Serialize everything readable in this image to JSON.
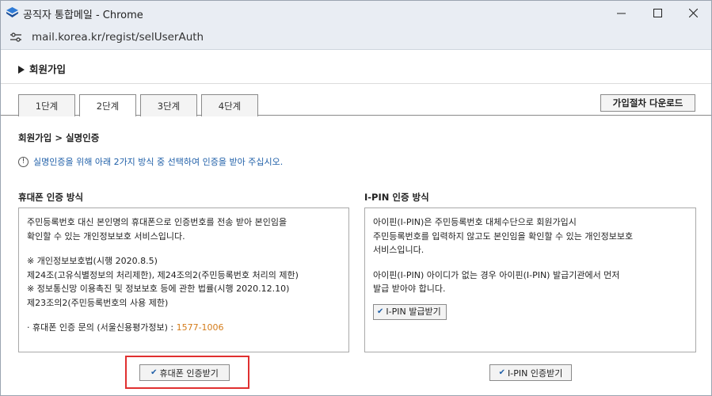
{
  "window": {
    "title": "공직자 통합메일 - Chrome",
    "url": "mail.korea.kr/regist/selUserAuth"
  },
  "page": {
    "title": "회원가입",
    "tabs": [
      {
        "label": "1단계",
        "active": false
      },
      {
        "label": "2단계",
        "active": true
      },
      {
        "label": "3단계",
        "active": false
      },
      {
        "label": "4단계",
        "active": false
      }
    ],
    "download_button": "가입절차 다운로드",
    "breadcrumb": "회원가입 > 실명인증",
    "notice": "실명인증을 위해 아래 2가지 방식 중 선택하여 인증을 받아 주십시오."
  },
  "phone_auth": {
    "title": "휴대폰 인증 방식",
    "lines": [
      "주민등록번호 대신 본인명의 휴대폰으로 인증번호를 전송 받아 본인임을",
      "확인할 수 있는 개인정보보호 서비스입니다."
    ],
    "law_lines": [
      "※ 개인정보보호법(시행 2020.8.5)",
      "제24조(고유식별정보의 처리제한), 제24조의2(주민등록번호 처리의 제한)",
      "※ 정보통신망 이용촉진 및 정보보호 등에 관한 법률(시행 2020.12.10)",
      "제23조의2(주민등록번호의 사용 제한)"
    ],
    "inquiry_label": "· 휴대폰 인증 문의 (서울신용평가정보) : ",
    "inquiry_phone": "1577-1006",
    "button": "휴대폰 인증받기"
  },
  "ipin_auth": {
    "title": "I-PIN 인증 방식",
    "lines": [
      "아이핀(I-PIN)은 주민등록번호 대체수단으로 회원가입시",
      "주민등록번호를 입력하지 않고도 본인임을 확인할 수 있는 개인정보보호",
      "서비스입니다."
    ],
    "lines2": [
      "아이핀(I-PIN) 아이디가 없는 경우 아이핀(I-PIN) 발급기관에서 먼저",
      "발급 받아야 합니다."
    ],
    "issue_button": "I-PIN 발급받기",
    "button": "I-PIN 인증받기"
  },
  "colors": {
    "notice": "#1f5fa8",
    "phone_number": "#d47c1a",
    "highlight": "#e03030"
  }
}
